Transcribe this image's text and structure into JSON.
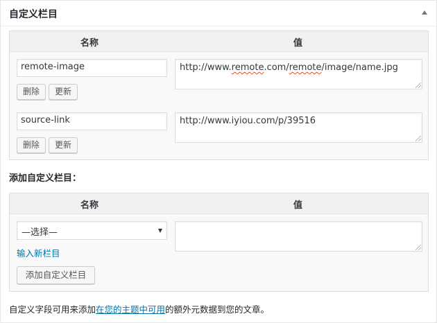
{
  "panel": {
    "title": "自定义栏目",
    "toggle_icon": "triangle-up-icon"
  },
  "existing_table": {
    "columns": {
      "name": "名称",
      "value": "值"
    },
    "rows": [
      {
        "key": "remote-image",
        "value_prefix": "http://www.",
        "value_misspelled": "remote",
        "value_mid": ".com/",
        "value_misspelled2": "remote",
        "value_suffix": "/image/name.jpg",
        "delete_label": "删除",
        "update_label": "更新"
      },
      {
        "key": "source-link",
        "value": "http://www.iyiou.com/p/39516",
        "delete_label": "删除",
        "update_label": "更新"
      }
    ]
  },
  "add_section": {
    "title": "添加自定义栏目：",
    "columns": {
      "name": "名称",
      "value": "值"
    },
    "select_value": "—选择—",
    "new_field_link": "输入新栏目",
    "add_button": "添加自定义栏目",
    "value_text": ""
  },
  "footer": {
    "before": "自定义字段可用来添加",
    "link": "在您的主题中可用",
    "after": "的额外元数据到您的文章。"
  },
  "colors": {
    "link": "#0073aa",
    "border": "#dddddd",
    "header_bg": "#f1f1f1",
    "table_bg": "#f9f9f9",
    "spell_underline": "#d54e21"
  }
}
